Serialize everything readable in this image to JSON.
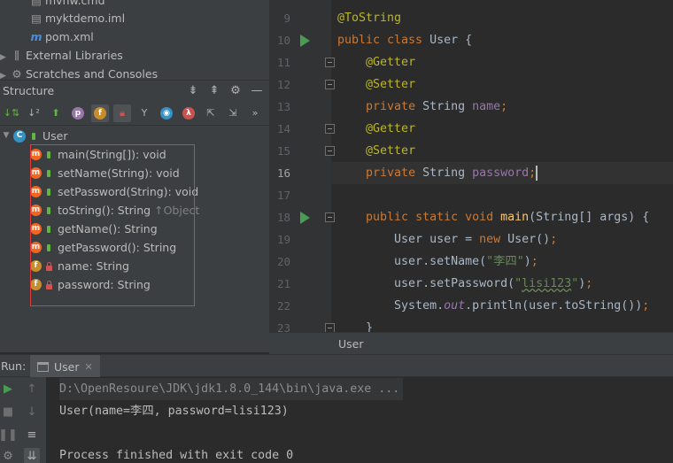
{
  "project": {
    "items": [
      {
        "label": "mvnw.cmd"
      },
      {
        "label": "myktdemo.iml"
      },
      {
        "label": "pom.xml"
      },
      {
        "label": "External Libraries"
      },
      {
        "label": "Scratches and Consoles"
      }
    ]
  },
  "structure": {
    "title": "Structure",
    "root": "User",
    "members": [
      {
        "kind": "m",
        "name": "main(String[]): void",
        "suffix": ""
      },
      {
        "kind": "m",
        "name": "setName(String): void",
        "suffix": ""
      },
      {
        "kind": "m",
        "name": "setPassword(String): void",
        "suffix": ""
      },
      {
        "kind": "m",
        "name": "toString(): String",
        "suffix": "↑Object"
      },
      {
        "kind": "m",
        "name": "getName(): String",
        "suffix": ""
      },
      {
        "kind": "m",
        "name": "getPassword(): String",
        "suffix": ""
      },
      {
        "kind": "f",
        "name": "name: String",
        "suffix": ""
      },
      {
        "kind": "f",
        "name": "password: String",
        "suffix": ""
      }
    ]
  },
  "editor": {
    "line_numbers": [
      "9",
      "10",
      "11",
      "12",
      "13",
      "14",
      "15",
      "16",
      "17",
      "18",
      "19",
      "20",
      "21",
      "22",
      "23"
    ],
    "current_line": "16",
    "breadcrumb": "User"
  },
  "run": {
    "label": "Run:",
    "tab": "User",
    "console": {
      "command": "D:\\OpenResoure\\JDK\\jdk1.8.0_144\\bin\\java.exe ...",
      "output": "User(name=李四, password=lisi123)",
      "finished": "Process finished with exit code 0"
    }
  }
}
